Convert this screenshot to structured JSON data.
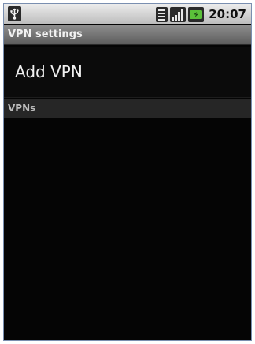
{
  "status_bar": {
    "time": "20:07",
    "icons": [
      "usb-icon",
      "wifi-icon",
      "signal-icon",
      "battery-charging-icon"
    ]
  },
  "header": {
    "title": "VPN settings"
  },
  "main": {
    "add_vpn_label": "Add VPN",
    "vpns_section_label": "VPNs"
  },
  "colors": {
    "background": "#050505",
    "title_bar": "#6e6e6e",
    "section_header": "#262626",
    "battery_accent": "#5bc13a"
  }
}
